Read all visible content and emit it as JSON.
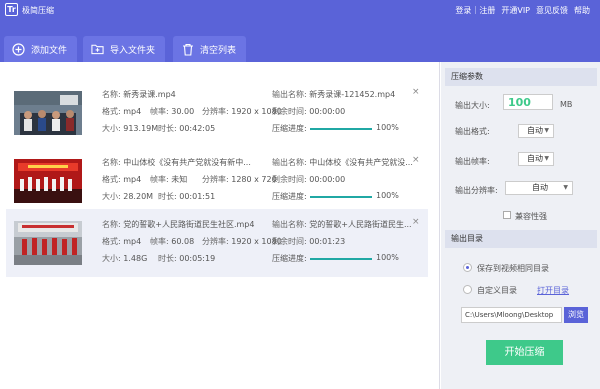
{
  "titlebar": {
    "app_title": "极简压缩",
    "logo_text": "Tr",
    "nav": [
      "登录｜注册",
      "开通VIP",
      "意见反馈",
      "帮助"
    ]
  },
  "toolbar": {
    "add_file": "添加文件",
    "import_folder": "导入文件夹",
    "clear_list": "清空列表"
  },
  "labels": {
    "name": "名称:",
    "format": "格式:",
    "framerate": "帧率:",
    "resolution": "分辨率:",
    "size": "大小:",
    "duration": "时长:",
    "out_name": "输出名称:",
    "remaining": "剩余时间:",
    "progress": "压缩进度:"
  },
  "files": [
    {
      "name": "新秀录课.mp4",
      "format": "mp4",
      "framerate": "30.00",
      "resolution": "1920 x 1080",
      "size": "913.19M",
      "duration": "00:42:05",
      "out_name": "新秀录课-121452.mp4",
      "remaining": "00:00:00",
      "progress": "100%",
      "progress_value": 1.0
    },
    {
      "name": "中山体校《没有共产党就没有新中...",
      "format": "mp4",
      "framerate": "未知",
      "resolution": "1280 x 720",
      "size": "28.20M",
      "duration": "00:01:51",
      "out_name": "中山体校《没有共产党就没...",
      "remaining": "00:00:00",
      "progress": "100%",
      "progress_value": 1.0
    },
    {
      "name": "党的誓歌+人民路街道民生社区.mp4",
      "format": "mp4",
      "framerate": "60.08",
      "resolution": "1920 x 1080",
      "size": "1.48G",
      "duration": "00:05:19",
      "out_name": "党的誓歌+人民路街道民生...",
      "remaining": "00:01:23",
      "progress": "100%",
      "progress_value": 1.0
    }
  ],
  "side": {
    "params_header": "压缩参数",
    "out_size_label": "输出大小:",
    "out_size_value": "100",
    "out_size_unit": "MB",
    "out_format_label": "输出格式:",
    "out_format_value": "自动",
    "out_framerate_label": "输出帧率:",
    "out_framerate_value": "自动",
    "out_resolution_label": "输出分辨率:",
    "out_resolution_value": "自动",
    "compat_label": "兼容性强",
    "dir_header": "输出目录",
    "save_same_label": "保存到视频相同目录",
    "custom_dir_label": "自定义目录",
    "open_dir_link": "打开目录",
    "path_value": "C:\\Users\\Mloong\\Desktop",
    "browse_label": "浏览",
    "start_label": "开始压缩"
  },
  "colors": {
    "accent": "#5a63d8",
    "progress": "#20a8a4",
    "value_green": "#3ec98a"
  }
}
